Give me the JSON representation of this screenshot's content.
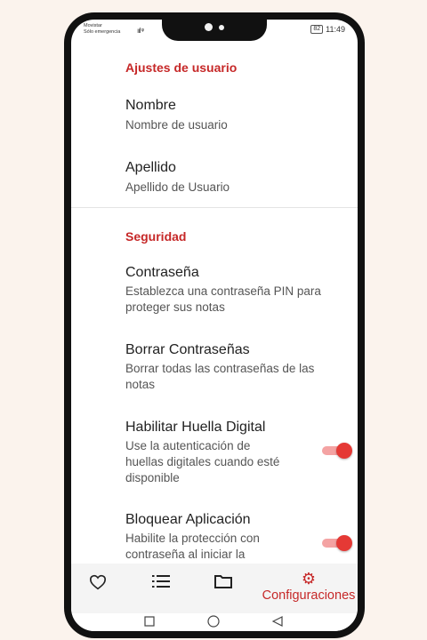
{
  "status_bar": {
    "carrier": "Movistar",
    "carrier_sub": "Sólo emergencia",
    "signal": "ııl ᵠ",
    "battery": "82",
    "time": "11:49"
  },
  "sections": {
    "user": {
      "title": "Ajustes de usuario",
      "items": [
        {
          "title": "Nombre",
          "subtitle": "Nombre de usuario"
        },
        {
          "title": "Apellido",
          "subtitle": "Apellido de Usuario"
        }
      ]
    },
    "security": {
      "title": "Seguridad",
      "items": [
        {
          "title": "Contraseña",
          "subtitle_line1": "Establezca una contraseña PIN para",
          "subtitle_line2": "proteger sus notas"
        },
        {
          "title": "Borrar Contraseñas",
          "subtitle_line1": "Borrar todas las contraseñas de las",
          "subtitle_line2": "notas"
        },
        {
          "title": "Habilitar Huella Digital",
          "subtitle_line1": "Use la autenticación de",
          "subtitle_line2": "huellas digitales cuando esté",
          "subtitle_line3": "disponible",
          "switch_on": true
        },
        {
          "title": "Bloquear Aplicación",
          "subtitle_line1": "Habilite la protección con",
          "subtitle_line2": "contraseña al iniciar la",
          "switch_on": true
        }
      ]
    }
  },
  "bottom_nav": {
    "favorites_icon": "heart-icon",
    "list_icon": "list-icon",
    "folder_icon": "folder-icon",
    "settings_icon": "gear-icon",
    "settings_label": "Configuraciones"
  },
  "colors": {
    "accent": "#c62828",
    "switch_thumb": "#e53935",
    "switch_track": "#f4a3a3"
  }
}
